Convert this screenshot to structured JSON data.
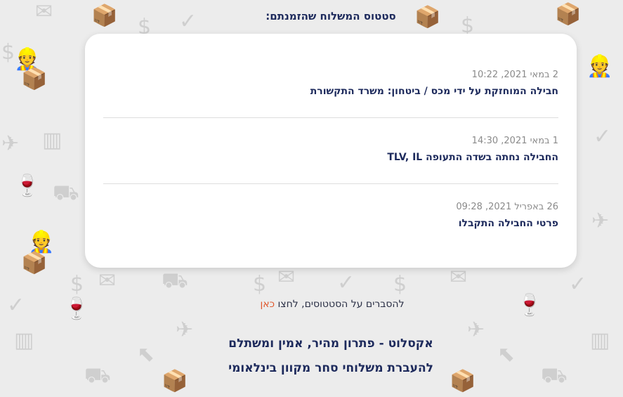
{
  "page_title": "סטטוס המשלוח שהזמנתם:",
  "status_entries": [
    {
      "date": "2 במאי 2021, 10:22",
      "text": "חבילה המוחזקת על ידי מכס / ביטחון: משרד התקשורת"
    },
    {
      "date": "1 במאי 2021, 14:30",
      "text": "החבילה נחתה בשדה התעופה TLV, IL"
    },
    {
      "date": "26 באפריל 2021, 09:28",
      "text": "פרטי החבילה התקבלו"
    }
  ],
  "help": {
    "prefix": "להסברים על הסטטוסים, לחצו ",
    "link_label": "כאן"
  },
  "slogan": {
    "line1": "אקסלוט - פתרון מהיר, אמין ומשתלם",
    "line2": "להעברת משלוחי סחר מקוון בינלאומי"
  },
  "colors": {
    "title": "#1d2a5c",
    "link": "#e0572c",
    "date": "#8a8a8a",
    "background": "#ececec"
  },
  "background_icons": [
    "shipping-box-icon",
    "dollar-icon",
    "airplane-icon",
    "checkmark-icon",
    "envelope-icon",
    "wine-glass-icon",
    "cargo-container-icon",
    "hand-truck-icon",
    "delivery-person-icon",
    "cursor-icon"
  ]
}
